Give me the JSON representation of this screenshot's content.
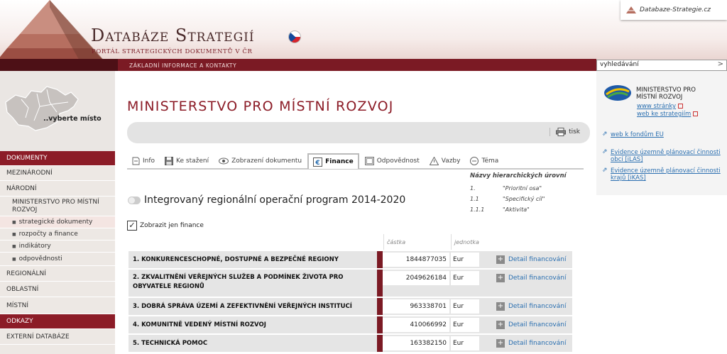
{
  "header": {
    "brand_title": "Databáze Strategií",
    "brand_subtitle": "PORTÁL STRATEGICKÝCH DOKUMENTŮ V ČR",
    "site_tab": "Databaze-Strategie.cz",
    "topbar_link": "ZÁKLADNÍ INFORMACE A KONTAKTY",
    "search_placeholder": "vyhledávání",
    "search_go": ">"
  },
  "sidebar": {
    "map_label": "..vyberte místo",
    "items": [
      {
        "label": "DOKUMENTY"
      },
      {
        "label": "MEZINÁRODNÍ"
      },
      {
        "label": "NÁRODNÍ"
      },
      {
        "label": "MINISTERSTVO PRO MÍSTNÍ ROZVOJ"
      },
      {
        "label": "strategické dokumenty"
      },
      {
        "label": "rozpočty a finance"
      },
      {
        "label": "indikátory"
      },
      {
        "label": "odpovědnosti"
      },
      {
        "label": "REGIONÁLNÍ"
      },
      {
        "label": "OBLASTNÍ"
      },
      {
        "label": "MÍSTNÍ"
      },
      {
        "label": "ODKAZY"
      },
      {
        "label": "EXTERNÍ DATABÁZE"
      }
    ]
  },
  "main": {
    "title": "MINISTERSTVO PRO MÍSTNÍ ROZVOJ",
    "print_label": "tisk",
    "tabs": [
      {
        "label": "Info"
      },
      {
        "label": "Ke stažení"
      },
      {
        "label": "Zobrazení dokumentu"
      },
      {
        "label": "Finance"
      },
      {
        "label": "Odpovědnost"
      },
      {
        "label": "Vazby"
      },
      {
        "label": "Téma"
      }
    ],
    "levels": {
      "title": "Názvy hierarchických úrovní",
      "rows": [
        {
          "num": "1.",
          "name": "\"Prioritní osa\""
        },
        {
          "num": "1.1",
          "name": "\"Specifický cíl\""
        },
        {
          "num": "1.1.1",
          "name": "\"Aktivita\""
        }
      ]
    },
    "program_name": "Integrovaný regionální operační program 2014-2020",
    "filter_label": "Zobrazit jen finance",
    "filter_check": "✓",
    "columns": {
      "amount": "částka",
      "unit": "jednotka"
    },
    "detail_label": "Detail financování",
    "rows": [
      {
        "name": "1. KONKURENCESCHOPNÉ, DOSTUPNÉ A BEZPEČNÉ REGIONY",
        "amount": "1844877035",
        "unit": "Eur"
      },
      {
        "name": "2. ZKVALITNĚNÍ VEŘEJNÝCH SLUŽEB A PODMÍNEK ŽIVOTA PRO OBYVATELE REGIONŮ",
        "amount": "2049626184",
        "unit": "Eur"
      },
      {
        "name": "3. DOBRÁ SPRÁVA ÚZEMÍ A ZEFEKTIVNĚNÍ VEŘEJNÝCH INSTITUCÍ",
        "amount": "963338701",
        "unit": "Eur"
      },
      {
        "name": "4. KOMUNITNĚ VEDENÝ MÍSTNÍ ROZVOJ",
        "amount": "410066992",
        "unit": "Eur"
      },
      {
        "name": "5. TECHNICKÁ POMOC",
        "amount": "163382150",
        "unit": "Eur"
      }
    ]
  },
  "right": {
    "ministry_name": "MINISTERSTVO PRO MÍSTNÍ ROZVOJ",
    "links": [
      {
        "label": "www stránky"
      },
      {
        "label": "web ke strategiím"
      },
      {
        "label": "web k fondům EU"
      },
      {
        "label": "Evidence územně plánovací činnosti obcí [iLAS]"
      },
      {
        "label": "Evidence územně plánovací činnosti krajů [iKAS]"
      }
    ]
  }
}
